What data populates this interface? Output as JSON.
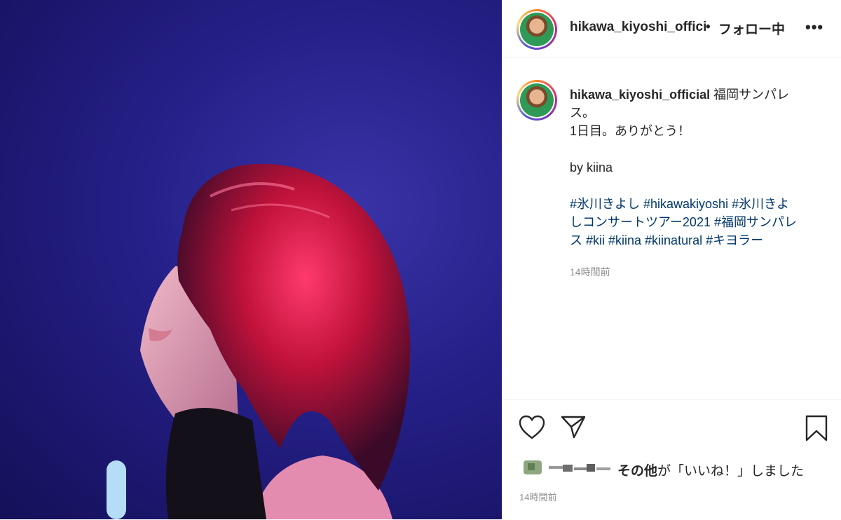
{
  "header": {
    "username": "hikawa_kiyoshi_offici",
    "separator": "•",
    "follow_label": "フォロー中",
    "more_label": "•••"
  },
  "caption": {
    "username": "hikawa_kiyoshi_official",
    "line1": "福岡サンパレ",
    "line2": "ス。",
    "line3": "1日目。ありがとう！",
    "line4": "by kiina",
    "tags_line1": "#氷川きよし #hikawakiyoshi #氷川きよ",
    "tags_line2": "しコンサートツアー2021 #福岡サンパレ",
    "tags_line3": "ス #kii #kiina #kiinatural #キヨラー",
    "time": "14時間前"
  },
  "actions": {
    "like_icon": "heart-outline-icon",
    "share_icon": "paper-plane-icon",
    "save_icon": "bookmark-outline-icon"
  },
  "likes": {
    "others_label": "その他",
    "suffix": "が「いいね！」しました"
  },
  "post_time": "14時間前",
  "colors": {
    "hashtag": "#00376b",
    "text": "#262626",
    "muted": "#8e8e8e",
    "photo_background": "#241f86",
    "hair": "#c0123a"
  }
}
